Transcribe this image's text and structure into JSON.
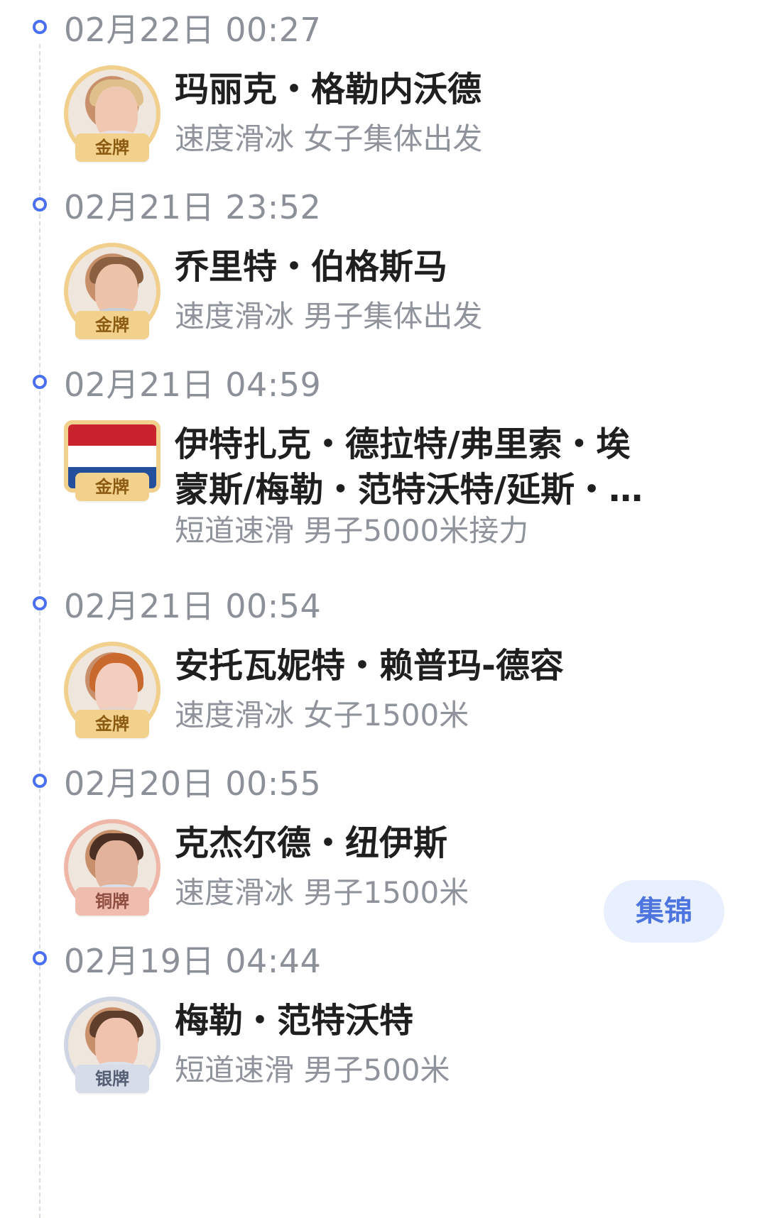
{
  "timeline": [
    {
      "time": "02月22日 00:27",
      "name": "玛丽克・格勒内沃德",
      "event": "速度滑冰 女子集体出发",
      "medal": "金牌",
      "avatar_icon": "athlete-portrait-icon",
      "medal_color": "#f1cf8d"
    },
    {
      "time": "02月21日 23:52",
      "name": "乔里特・伯格斯马",
      "event": "速度滑冰 男子集体出发",
      "medal": "金牌",
      "avatar_icon": "athlete-portrait-icon",
      "medal_color": "#f1cf8d"
    },
    {
      "time": "02月21日 04:59",
      "name": "伊特扎克・德拉特/弗里索・埃\n蒙斯/梅勒・范特沃特/延斯・…",
      "event": "短道速滑 男子5000米接力",
      "medal": "金牌",
      "avatar_icon": "netherlands-flag-icon",
      "medal_color": "#f1cf8d"
    },
    {
      "time": "02月21日 00:54",
      "name": "安托瓦妮特・赖普玛-德容",
      "event": "速度滑冰 女子1500米",
      "medal": "金牌",
      "avatar_icon": "athlete-portrait-icon",
      "medal_color": "#f1cf8d"
    },
    {
      "time": "02月20日 00:55",
      "name": "克杰尔德・纽伊斯",
      "event": "速度滑冰 男子1500米",
      "medal": "铜牌",
      "avatar_icon": "athlete-portrait-icon",
      "medal_color": "#efb7a7",
      "action_label": "集锦"
    },
    {
      "time": "02月19日 04:44",
      "name": "梅勒・范特沃特",
      "event": "短道速滑 男子500米",
      "medal": "银牌",
      "avatar_icon": "athlete-portrait-icon",
      "medal_color": "#cfd5e2"
    }
  ]
}
